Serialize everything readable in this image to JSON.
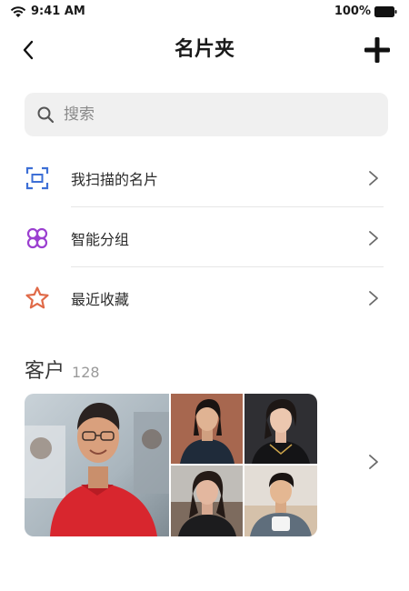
{
  "status_bar": {
    "time": "9:41 AM",
    "battery": "100%"
  },
  "nav": {
    "title": "名片夹",
    "back_icon": "chevron-left-icon",
    "add_icon": "plus-icon"
  },
  "search": {
    "placeholder": "搜索",
    "value": ""
  },
  "menu": {
    "items": [
      {
        "label": "我扫描的名片",
        "icon": "scan-icon",
        "color": "#3d6fd6"
      },
      {
        "label": "智能分组",
        "icon": "smart-group-icon",
        "color": "#9b3fd0"
      },
      {
        "label": "最近收藏",
        "icon": "star-icon",
        "color": "#e06a48"
      }
    ]
  },
  "clients": {
    "title": "客户",
    "count": "128"
  },
  "colors": {
    "accent_blue": "#3d6fd6",
    "accent_purple": "#9b3fd0",
    "accent_orange": "#e06a48",
    "search_bg": "#f0f0f0",
    "divider": "#e6e6e6"
  }
}
